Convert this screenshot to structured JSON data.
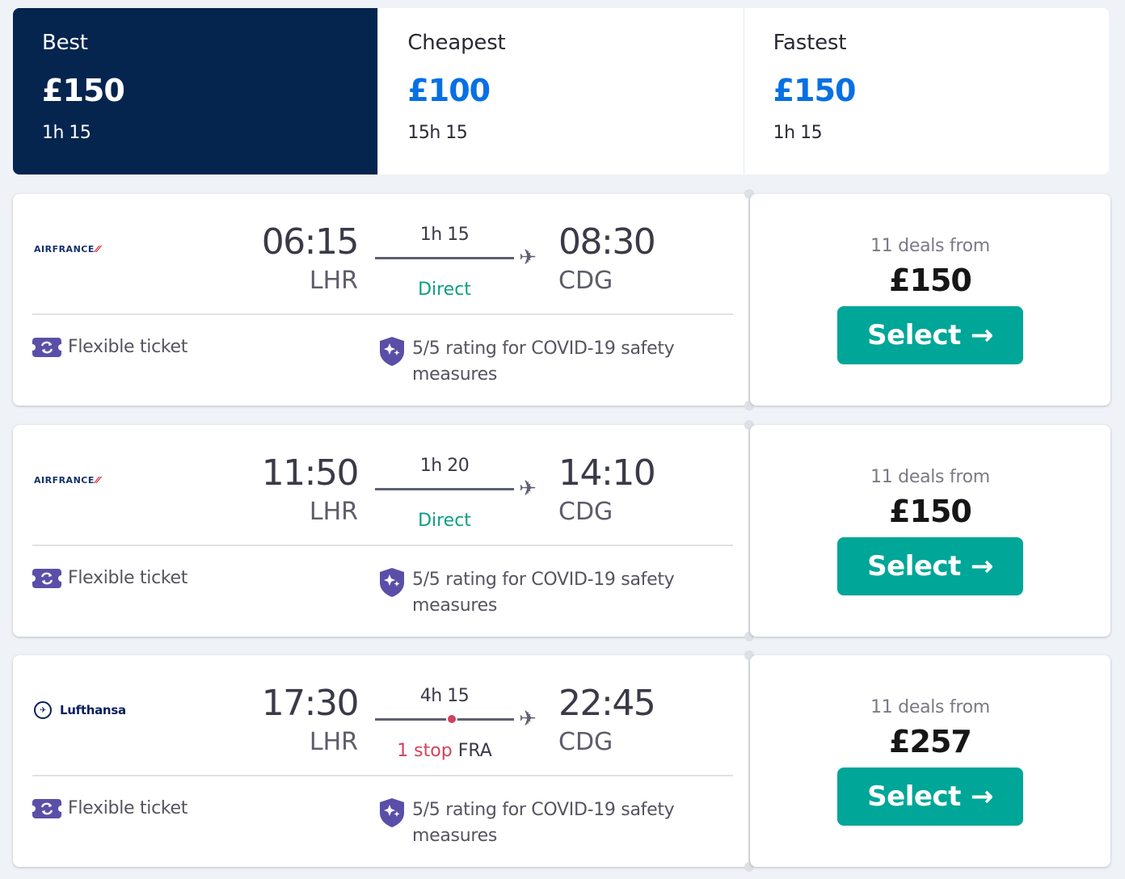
{
  "sort_tabs": [
    {
      "label": "Best",
      "price": "£150",
      "duration": "1h 15"
    },
    {
      "label": "Cheapest",
      "price": "£100",
      "duration": "15h 15"
    },
    {
      "label": "Fastest",
      "price": "£150",
      "duration": "1h 15"
    }
  ],
  "results": [
    {
      "airline": "AIRFRANCE",
      "dep_time": "06:15",
      "dep_airport": "LHR",
      "duration": "1h 15",
      "arr_time": "08:30",
      "arr_airport": "CDG",
      "stops_label": "Direct",
      "feature_flex": "Flexible ticket",
      "feature_covid": "5/5 rating for COVID-19 safety measures",
      "deals_text": "11 deals from",
      "price": "£150",
      "button_label": "Select"
    },
    {
      "airline": "AIRFRANCE",
      "dep_time": "11:50",
      "dep_airport": "LHR",
      "duration": "1h 20",
      "arr_time": "14:10",
      "arr_airport": "CDG",
      "stops_label": "Direct",
      "feature_flex": "Flexible ticket",
      "feature_covid": "5/5 rating for COVID-19 safety measures",
      "deals_text": "11 deals from",
      "price": "£150",
      "button_label": "Select"
    },
    {
      "airline": "Lufthansa",
      "dep_time": "17:30",
      "dep_airport": "LHR",
      "duration": "4h 15",
      "arr_time": "22:45",
      "arr_airport": "CDG",
      "stops_label": "1 stop",
      "stop_via": "FRA",
      "feature_flex": "Flexible ticket",
      "feature_covid": "5/5 rating for COVID-19 safety measures",
      "deals_text": "11 deals from",
      "price": "£257",
      "button_label": "Select"
    }
  ],
  "colors": {
    "active_tab": "#05254f",
    "price_accent": "#0770e3",
    "select_button": "#00a698",
    "direct": "#0c9e86",
    "stop": "#d1435b",
    "feature_icon": "#5a4fa8"
  },
  "icons": {
    "flex": "flexible-ticket-icon",
    "covid": "shield-sparkle-icon",
    "plane": "plane-icon",
    "arrow": "arrow-right-icon"
  }
}
